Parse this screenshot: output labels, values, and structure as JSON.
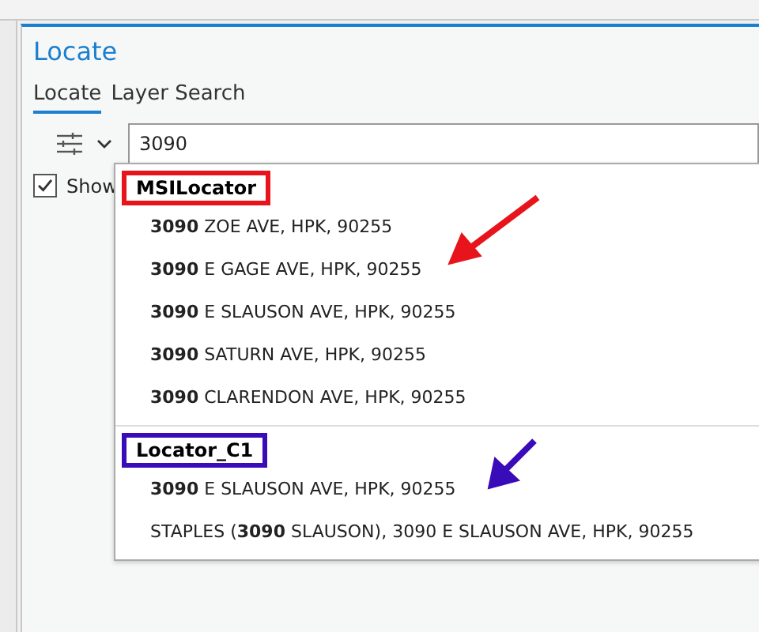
{
  "panel": {
    "title": "Locate"
  },
  "tabs": [
    {
      "label": "Locate",
      "selected": true
    },
    {
      "label": "Layer Search",
      "selected": false
    }
  ],
  "search": {
    "value": "3090"
  },
  "show_option": {
    "label": "Show",
    "checked": true
  },
  "results": [
    {
      "locator": "MSILocator",
      "color": "#e8141c",
      "items": [
        "**3090** ZOE AVE, HPK, 90255",
        "**3090** E GAGE AVE, HPK, 90255",
        "**3090** E SLAUSON AVE, HPK, 90255",
        "**3090** SATURN AVE, HPK, 90255",
        "**3090** CLARENDON AVE, HPK, 90255"
      ]
    },
    {
      "locator": "Locator_C1",
      "color": "#3a0bb8",
      "items": [
        "**3090** E SLAUSON AVE, HPK, 90255",
        "STAPLES (**3090** SLAUSON), 3090 E SLAUSON AVE, HPK, 90255"
      ]
    }
  ]
}
